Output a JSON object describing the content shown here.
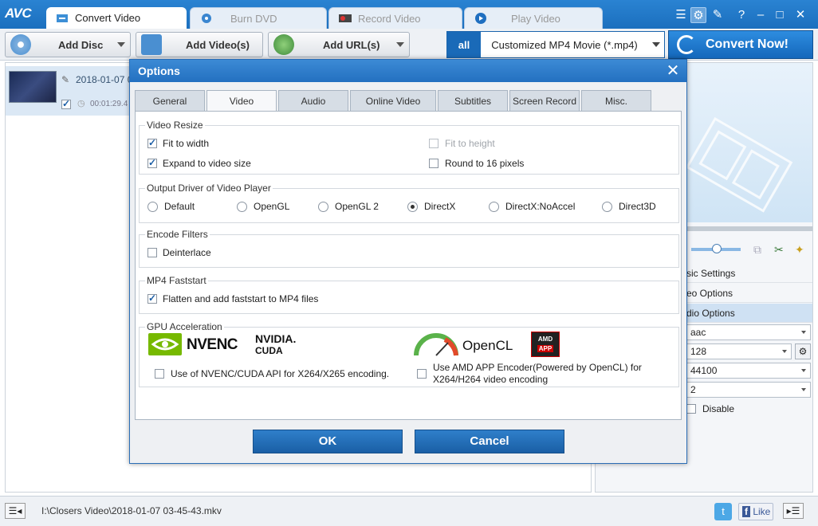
{
  "app": {
    "logo": "AVC"
  },
  "tabs": [
    {
      "label": "Convert Video",
      "icon": "convert-icon"
    },
    {
      "label": "Burn DVD",
      "icon": "disc-icon"
    },
    {
      "label": "Record Video",
      "icon": "record-icon"
    },
    {
      "label": "Play Video",
      "icon": "play-icon"
    }
  ],
  "toolbar": {
    "add_disc": "Add Disc",
    "add_videos": "Add Video(s)",
    "add_url": "Add URL(s)",
    "profile_icon_text": "all",
    "profile": "Customized MP4 Movie (*.mp4)",
    "convert_now": "Convert Now!"
  },
  "file": {
    "name": "2018-01-07 0",
    "duration": "00:01:29.4"
  },
  "right_panel": {
    "items": [
      "sic Settings",
      "eo Options",
      "dio Options"
    ],
    "combos": [
      "aac",
      "128",
      "44100",
      "2"
    ],
    "disable_label": "Disable"
  },
  "status": {
    "path": "I:\\Closers Video\\2018-01-07 03-45-43.mkv",
    "like": "Like"
  },
  "dialog": {
    "title": "Options",
    "tabs": [
      "General",
      "Video",
      "Audio",
      "Online Video",
      "Subtitles",
      "Screen Record",
      "Misc."
    ],
    "video_resize": {
      "title": "Video Resize",
      "fit_to_width": "Fit to width",
      "fit_to_height": "Fit to height",
      "expand": "Expand to video size",
      "round16": "Round to 16 pixels"
    },
    "output_driver": {
      "title": "Output Driver of Video Player",
      "options": [
        "Default",
        "OpenGL",
        "OpenGL 2",
        "DirectX",
        "DirectX:NoAccel",
        "Direct3D"
      ],
      "selected": "DirectX"
    },
    "encode_filters": {
      "title": "Encode Filters",
      "deinterlace": "Deinterlace"
    },
    "mp4_faststart": {
      "title": "MP4 Faststart",
      "flatten": "Flatten and add faststart to MP4 files"
    },
    "gpu": {
      "title": "GPU Acceleration",
      "nvenc_logo": "NVENC",
      "nvidia_logo_1": "NVIDIA.",
      "nvidia_logo_2": "CUDA",
      "opencl_logo": "OpenCL",
      "amd_logo_1": "AMD",
      "amd_logo_2": "APP",
      "nvenc_label": "Use of NVENC/CUDA API for X264/X265 encoding.",
      "amd_label_1": "Use AMD APP Encoder(Powered by OpenCL) for",
      "amd_label_2": "X264/H264 video encoding"
    },
    "ok": "OK",
    "cancel": "Cancel"
  }
}
